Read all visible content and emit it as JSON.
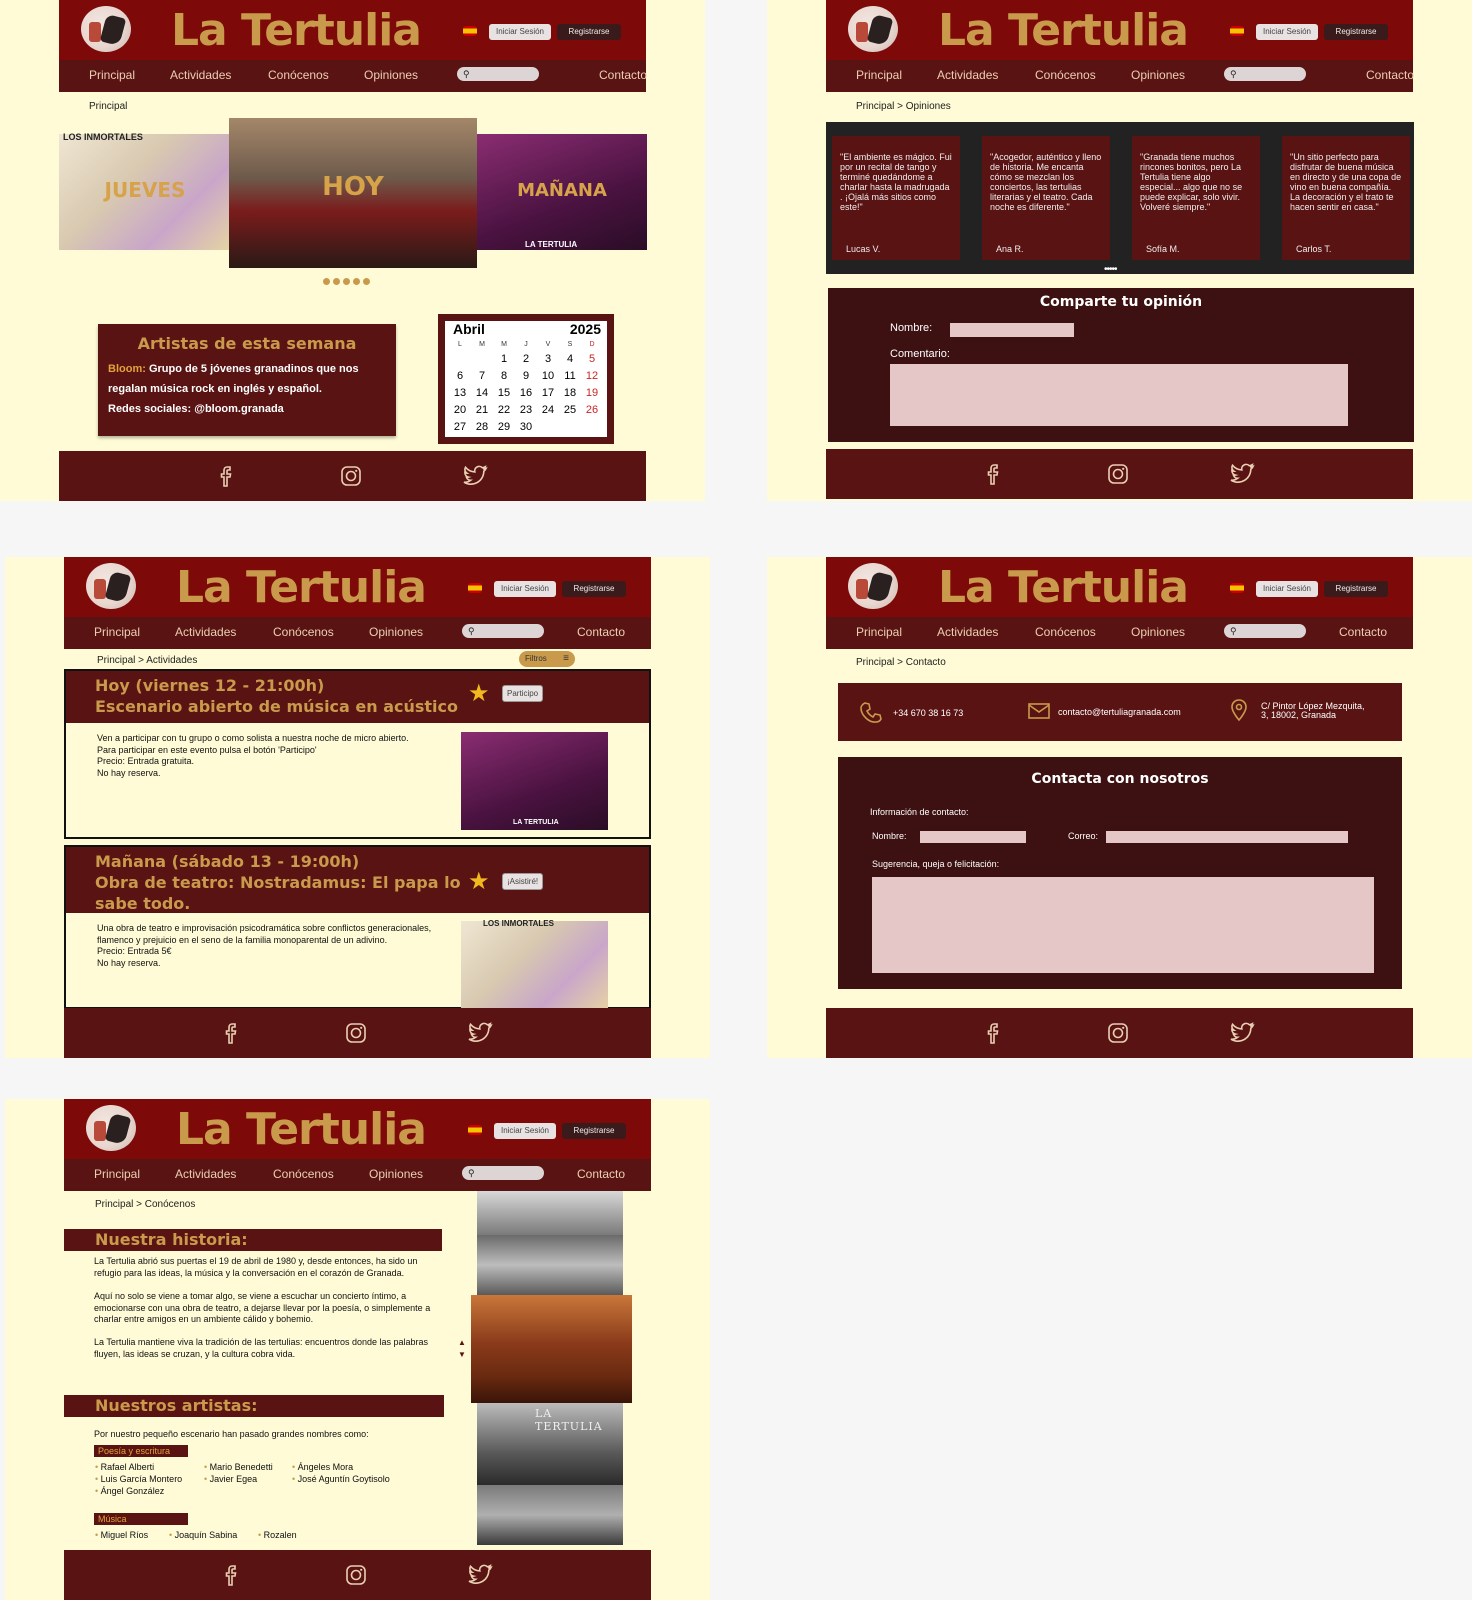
{
  "site": {
    "brand": "La Tertulia",
    "login": "Iniciar Sesión",
    "register": "Registrarse",
    "nav": [
      "Principal",
      "Actividades",
      "Conócenos",
      "Opiniones",
      "Contacto"
    ],
    "colors": {
      "header": "#7d0909",
      "nav": "#5a1313",
      "gold": "#c99a4b",
      "bg": "#fefbd6"
    }
  },
  "p1": {
    "crumb": "Principal",
    "slides": [
      "JUEVES",
      "HOY",
      "MAÑANA"
    ],
    "slide_caption": "LA TERTULIA",
    "slide_top": "LOS INMORTALES",
    "artists_title": "Artistas de esta semana",
    "artist_name": "Bloom:",
    "artist_desc": "Grupo de 5 jóvenes granadinos que nos regalan música rock en inglés y español.",
    "artist_social": "Redes sociales: @bloom.granada",
    "cal_month": "Abril",
    "cal_year": "2025",
    "cal_days": [
      "L",
      "M",
      "M",
      "J",
      "V",
      "S",
      "D"
    ],
    "cal_dates": [
      "",
      "",
      "1",
      "2",
      "3",
      "4",
      "5",
      "6",
      "7",
      "8",
      "9",
      "10",
      "11",
      "12",
      "13",
      "14",
      "15",
      "16",
      "17",
      "18",
      "19",
      "20",
      "21",
      "22",
      "23",
      "24",
      "25",
      "26",
      "27",
      "28",
      "29",
      "30"
    ]
  },
  "p2": {
    "crumb": "Principal > Opiniones",
    "quotes": [
      {
        "text": "\"El ambiente es mágico. Fui por un recital de tango y terminé quedándome a charlar hasta la madrugada . ¡Ojalá más sitios como este!\"",
        "who": "Lucas V."
      },
      {
        "text": "\"Acogedor, auténtico y lleno de historia. Me encanta cómo se mezclan los conciertos, las tertulias literarias y el teatro. Cada noche es diferente.\"",
        "who": "Ana R."
      },
      {
        "text": "\"Granada tiene muchos rincones bonitos, pero La Tertulia tiene algo especial... algo que no se puede explicar, solo vivir. Volveré siempre.\"",
        "who": "Sofía M."
      },
      {
        "text": "\"Un sitio perfecto para disfrutar de buena música en directo y de una copa de vino en buena compañía. La decoración y el trato te hacen sentir en casa.\"",
        "who": "Carlos T."
      }
    ],
    "form_title": "Comparte tu opinión",
    "name_label": "Nombre:",
    "comment_label": "Comentario:"
  },
  "p3": {
    "crumb": "Principal > Actividades",
    "filters": "Filtros",
    "events": [
      {
        "title1": "Hoy (viernes 12 - 21:00h)",
        "title2": "Escenario abierto de música en acústico",
        "title3": "",
        "action": "Participo",
        "lines": [
          "Ven a participar con tu grupo o como solista a nuestra noche de micro abierto.",
          "Para participar en este evento pulsa el botón 'Participo'",
          "Precio: Entrada gratuita.",
          "No hay reserva."
        ]
      },
      {
        "title1": "Mañana (sábado 13 - 19:00h)",
        "title2": "Obra de teatro: Nostradamus: El papa lo",
        "title3": "sabe todo.",
        "action": "¡Asistiré!",
        "lines": [
          "Una obra de teatro e improvisación psicodramática sobre conflictos generacionales, flamenco y prejuicio en el seno de la familia monoparental de un adivino.",
          "Precio: Entrada 5€",
          "No hay reserva."
        ]
      }
    ],
    "img_caption": "LA TERTULIA",
    "img_top": "LOS INMORTALES"
  },
  "p4": {
    "crumb": "Principal > Contacto",
    "phone": "+34 670 38 16 73",
    "email": "contacto@tertuliagranada.com",
    "address1": "C/ Pintor López Mezquita,",
    "address2": "3, 18002, Granada",
    "form_title": "Contacta con nosotros",
    "info_label": "Información de contacto:",
    "name_label": "Nombre:",
    "mail_label": "Correo:",
    "msg_label": "Sugerencia, queja o felicitación:"
  },
  "p5": {
    "crumb": "Principal > Conócenos",
    "history_title": "Nuestra historia:",
    "history": [
      "La Tertulia abrió sus puertas el 19 de abril de 1980 y, desde entonces, ha sido un refugio para las ideas, la música y la conversación en el corazón de Granada.",
      "Aquí no solo se viene a tomar algo, se viene a escuchar un concierto íntimo, a emocionarse con una obra de teatro, a dejarse llevar por la poesía, o simplemente a charlar entre amigos en un ambiente cálido y bohemio.",
      "La Tertulia mantiene viva la tradición de las tertulias: encuentros donde las palabras fluyen, las ideas se cruzan, y la cultura cobra vida."
    ],
    "artists_title": "Nuestros artistas:",
    "artists_intro": "Por nuestro pequeño escenario han pasado grandes nombres como:",
    "poetry_tag": "Poesía y escritura",
    "poetry": [
      "Rafael Alberti",
      "Luis García Montero",
      "Ángel González",
      "Mario Benedetti",
      "Javier Egea",
      "Ángeles  Mora",
      "José Aguntín Goytisolo"
    ],
    "music_tag": "Música",
    "music": [
      "Miguel Ríos",
      "Joaquín Sabina",
      "Rozalen"
    ],
    "gallery_caption": "LA TERTULIA"
  }
}
